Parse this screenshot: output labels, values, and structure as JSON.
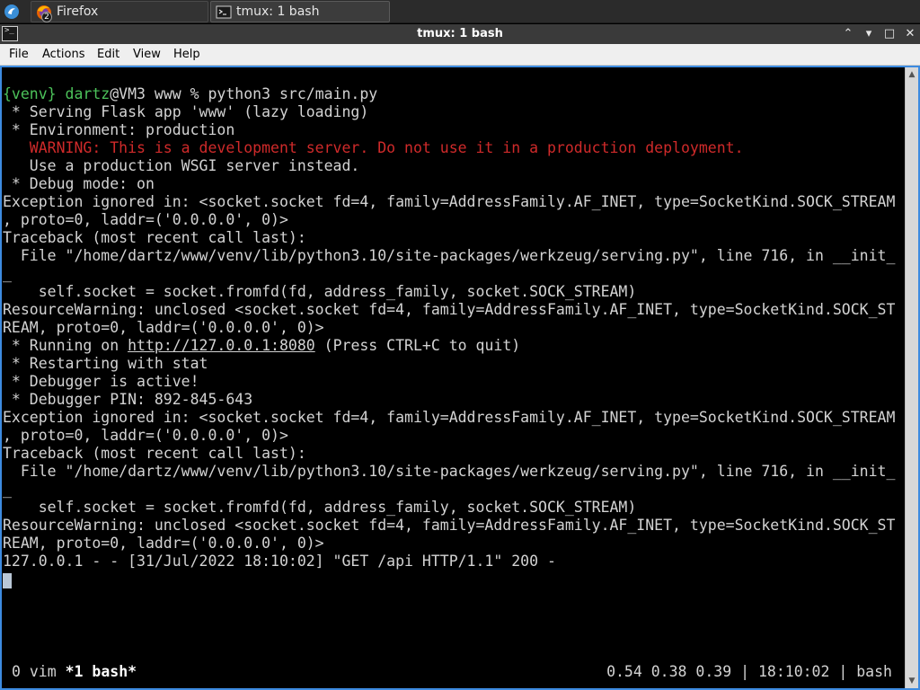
{
  "taskbar": {
    "tasks": [
      {
        "label": "Firefox",
        "badge": "2",
        "icon": "firefox-icon"
      },
      {
        "label": "tmux: 1 bash",
        "icon": "terminal-icon"
      }
    ],
    "start_icon": "system-menu-icon"
  },
  "window": {
    "title": "tmux: 1 bash",
    "icon_text": ">_",
    "buttons": {
      "up": "⌃",
      "minimize": "▾",
      "maximize": "□",
      "close": "✕"
    }
  },
  "menu": {
    "items": [
      "File",
      "Actions",
      "Edit",
      "View",
      "Help"
    ]
  },
  "terminal": {
    "prompt": {
      "venv": "{venv}",
      "user": "dartz",
      "rest": "@VM3 www % python3 src/main.py"
    },
    "output_a": [
      " * Serving Flask app 'www' (lazy loading)",
      " * Environment: production"
    ],
    "warning": "   WARNING: This is a development server. Do not use it in a production deployment.",
    "output_b": [
      "   Use a production WSGI server instead.",
      " * Debug mode: on",
      "Exception ignored in: <socket.socket fd=4, family=AddressFamily.AF_INET, type=SocketKind.SOCK_STREAM",
      ", proto=0, laddr=('0.0.0.0', 0)>",
      "Traceback (most recent call last):",
      "  File \"/home/dartz/www/venv/lib/python3.10/site-packages/werkzeug/serving.py\", line 716, in __init_",
      "_",
      "    self.socket = socket.fromfd(fd, address_family, socket.SOCK_STREAM)",
      "ResourceWarning: unclosed <socket.socket fd=4, family=AddressFamily.AF_INET, type=SocketKind.SOCK_ST",
      "REAM, proto=0, laddr=('0.0.0.0', 0)>"
    ],
    "running": {
      "prefix": " * Running on ",
      "url": "http://127.0.0.1:8080",
      "suffix": " (Press CTRL+C to quit)"
    },
    "output_c": [
      " * Restarting with stat",
      " * Debugger is active!",
      " * Debugger PIN: 892-845-643",
      "Exception ignored in: <socket.socket fd=4, family=AddressFamily.AF_INET, type=SocketKind.SOCK_STREAM",
      ", proto=0, laddr=('0.0.0.0', 0)>",
      "Traceback (most recent call last):",
      "  File \"/home/dartz/www/venv/lib/python3.10/site-packages/werkzeug/serving.py\", line 716, in __init_",
      "_",
      "    self.socket = socket.fromfd(fd, address_family, socket.SOCK_STREAM)",
      "ResourceWarning: unclosed <socket.socket fd=4, family=AddressFamily.AF_INET, type=SocketKind.SOCK_ST",
      "REAM, proto=0, laddr=('0.0.0.0', 0)>",
      "127.0.0.1 - - [31/Jul/2022 18:10:02] \"GET /api HTTP/1.1\" 200 -"
    ]
  },
  "status": {
    "window0": "0 vim",
    "window1": "*1 bash*",
    "load": "0.54 0.38 0.39",
    "time": "18:10:02",
    "host": "bash",
    "separator": "|"
  },
  "colors": {
    "prompt_green": "#4cc25a",
    "warning_red": "#cf2a2a",
    "terminal_bg": "#000000",
    "frame_blue": "#3d8be0"
  }
}
